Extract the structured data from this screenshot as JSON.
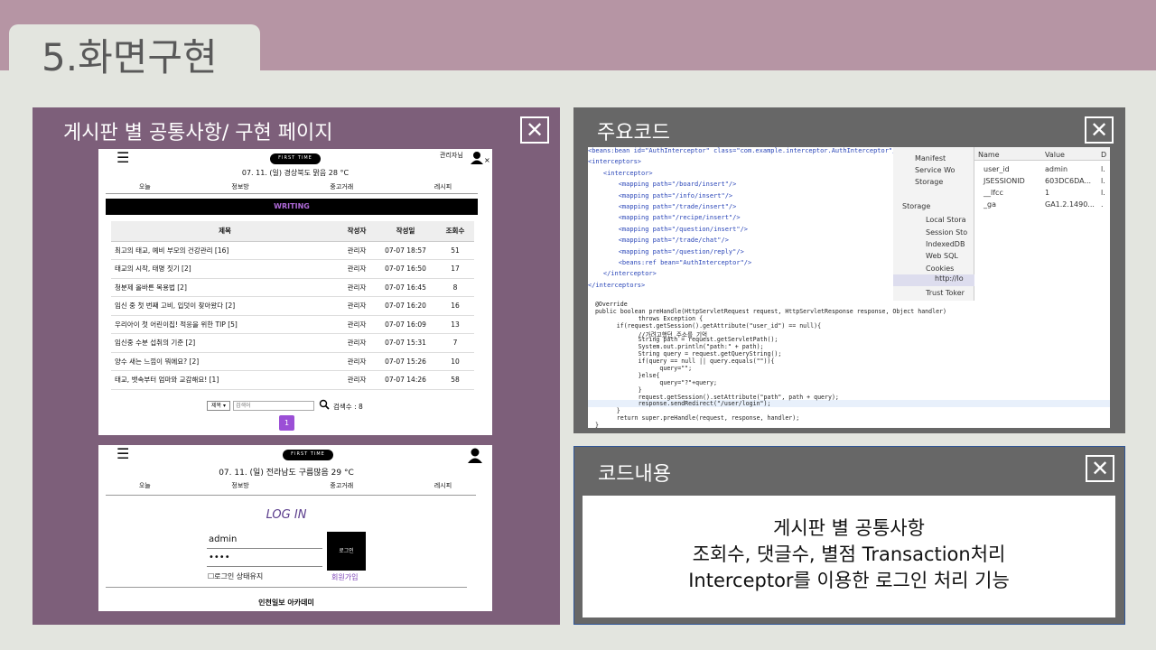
{
  "slide": {
    "title": "5.화면구현"
  },
  "panel_board": {
    "title": "게시판 별 공통사항/ 구현 페이지",
    "close": "✕"
  },
  "panel_code": {
    "title": "주요코드",
    "close": "✕"
  },
  "panel_desc": {
    "title": "코드내용",
    "close": "✕",
    "lines": [
      "게시판 별 공통사항",
      "조회수, 댓글수, 별점 Transaction처리",
      "Interceptor를 이용한 로그인 처리 기능"
    ]
  },
  "board": {
    "menu": "☰",
    "logo": "FIRST TIME",
    "user": "관리자님",
    "weather": "07. 11. (일)  경상북도 맑음 28 °C",
    "nav": [
      "오늘",
      "정보방",
      "중고거래",
      "레시피"
    ],
    "writing": "WRITING",
    "headers": [
      "제목",
      "작성자",
      "작성일",
      "조회수"
    ],
    "rows": [
      [
        "최고의 태교, 예비 부모의 건강관리  [16]",
        "관리자",
        "07-07 18:57",
        "51"
      ],
      [
        "태교의 시작, 태명 짓기  [2]",
        "관리자",
        "07-07 16:50",
        "17"
      ],
      [
        "청분제 올바른 복용법  [2]",
        "관리자",
        "07-07 16:45",
        "8"
      ],
      [
        "임신 중 첫 번째 고비, 입덧이 찾아왔다  [2]",
        "관리자",
        "07-07 16:20",
        "16"
      ],
      [
        "우리아이 첫 어린이집! 적응을 위한 TIP  [5]",
        "관리자",
        "07-07 16:09",
        "13"
      ],
      [
        "임신중 수분 섭취의 기준  [2]",
        "관리자",
        "07-07 15:31",
        "7"
      ],
      [
        "양수 새는 느낌이 뭐에요?  [2]",
        "관리자",
        "07-07 15:26",
        "10"
      ],
      [
        "태교, 뱃속부터 엄마와 교감해요!  [1]",
        "관리자",
        "07-07 14:26",
        "58"
      ]
    ],
    "search_select": "제목 ▾",
    "search_placeholder": "검색어",
    "search_count": "검색수 : 8",
    "page": "1"
  },
  "login": {
    "menu": "☰",
    "logo": "FIRST TIME",
    "weather": "07. 11. (일)  전라남도 구름많음 29 °C",
    "nav": [
      "오늘",
      "정보방",
      "중고거래",
      "레시피"
    ],
    "title": "LOG IN",
    "id_value": "admin",
    "pw_value": "••••",
    "login_button": "로그인",
    "keep": "☐로그인 상태유지",
    "join": "회원가입",
    "footer": "인천일보 아카데미"
  },
  "code": {
    "xml": [
      "<beans:bean id=\"AuthInterceptor\" class=\"com.example.interceptor.AuthInterceptor\"/>",
      "<interceptors>",
      "    <interceptor>",
      "        <mapping path=\"/board/insert\"/>",
      "        <mapping path=\"/info/insert\"/>",
      "        <mapping path=\"/trade/insert\"/>",
      "        <mapping path=\"/recipe/insert\"/>",
      "        <mapping path=\"/question/insert\"/>",
      "        <mapping path=\"/trade/chat\"/>",
      "        <mapping path=\"/question/reply\"/>",
      "        <beans:ref bean=\"AuthInterceptor\"/>",
      "    </interceptor>",
      "</interceptors>"
    ],
    "devtools": {
      "items": [
        "Manifest",
        "Service Wo",
        "Storage",
        "Storage",
        "Local Stora",
        "Session Sto",
        "IndexedDB",
        "Web SQL",
        "Cookies",
        "http://lo",
        "Trust Toker"
      ],
      "headers": [
        "Name",
        "Value",
        "D"
      ],
      "rows": [
        [
          "user_id",
          "admin",
          "l."
        ],
        [
          "JSESSIONID",
          "603DC6DA...",
          "l."
        ],
        [
          "__lfcc",
          "1",
          "l."
        ],
        [
          "_ga",
          "GA1.2.1490...",
          "."
        ]
      ]
    },
    "java": [
      "  @Override",
      "  public boolean preHandle(HttpServletRequest request, HttpServletResponse response, Object handler)",
      "              throws Exception {",
      "        if(request.getSession().getAttribute(\"user_id\") == null){",
      "              //가려고했던 주소를 기억",
      "              String path = request.getServletPath();",
      "              System.out.println(\"path:\" + path);",
      "              String query = request.getQueryString();",
      "              if(query == null || query.equals(\"\")){",
      "                    query=\"\";",
      "              }else{",
      "                    query=\"?\"+query;",
      "              }",
      "              request.getSession().setAttribute(\"path\", path + query);",
      "              response.sendRedirect(\"/user/login\");",
      "        }",
      "        return super.preHandle(request, response, handler);",
      "  }"
    ]
  }
}
